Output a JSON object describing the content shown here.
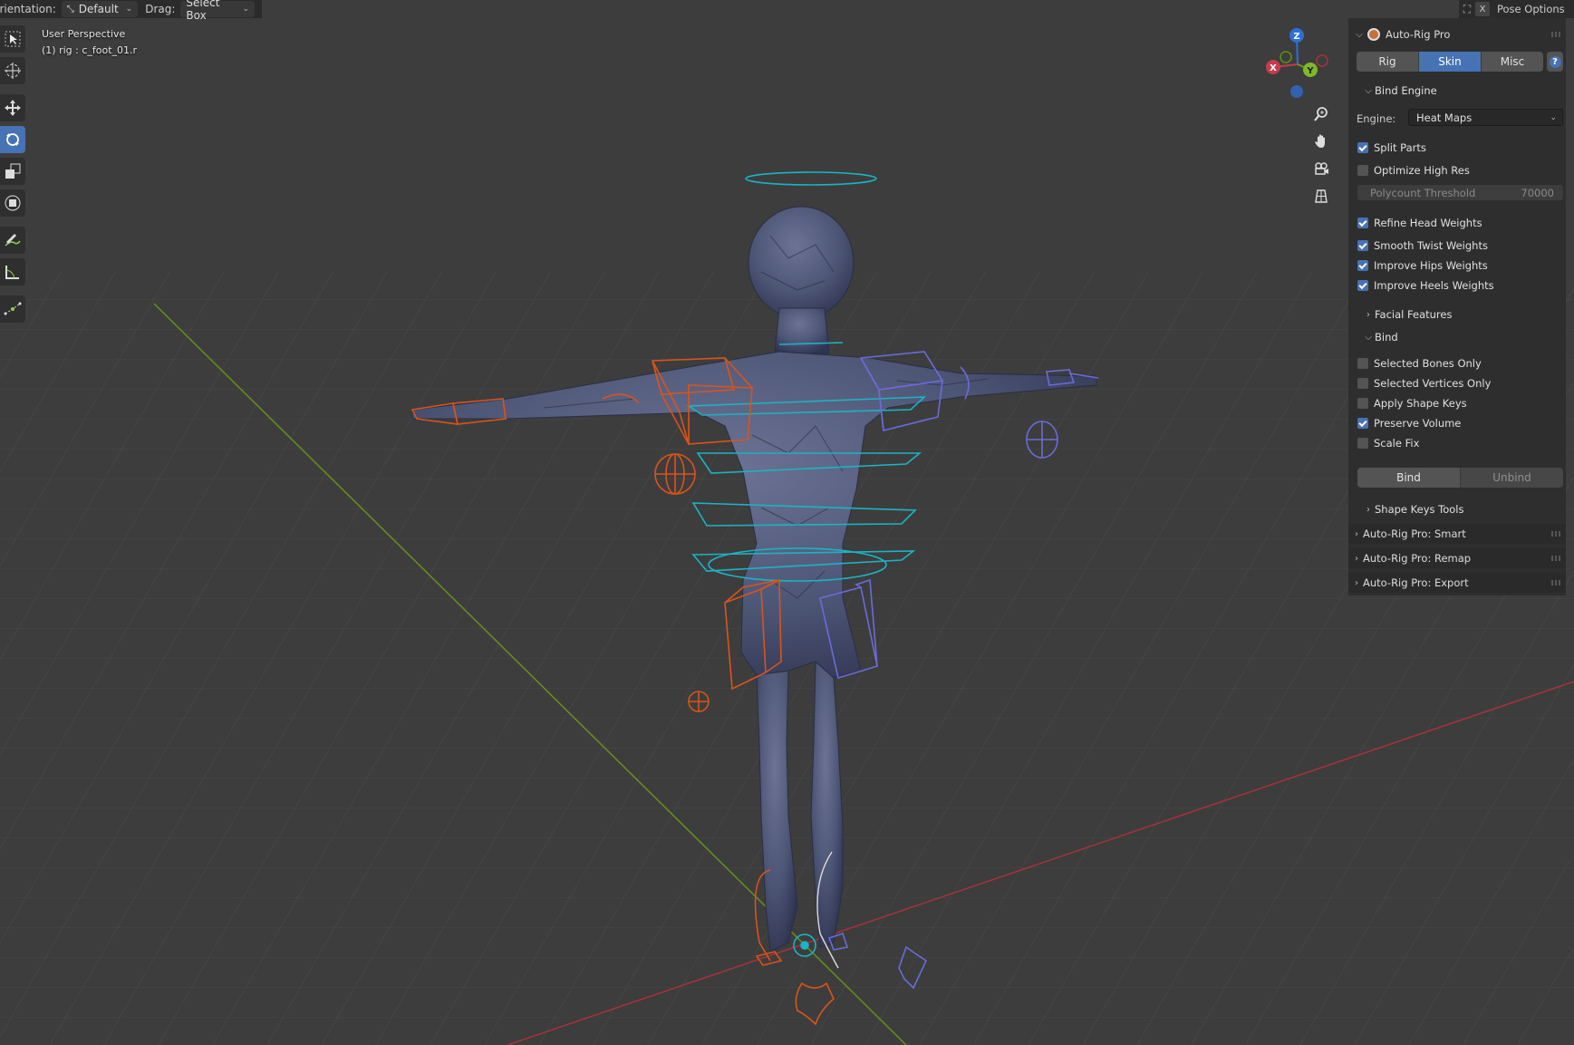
{
  "header": {
    "orientation_label": "Orientation:",
    "orientation_value": "Default",
    "drag_label": "Drag:",
    "drag_value": "Select Box",
    "close_label": "X",
    "pose_options": "Pose Options"
  },
  "viewport": {
    "perspective": "User Perspective",
    "selection": "(1) rig : c_foot_01.r"
  },
  "gizmo": {
    "z": "Z",
    "y": "Y",
    "x": "X"
  },
  "tools": [
    "select-box-icon",
    "cursor-icon",
    "move-icon",
    "rotate-icon",
    "scale-icon",
    "transform-icon",
    "annotate-icon",
    "measure-icon",
    "bone-curve-icon"
  ],
  "panel": {
    "title": "Auto-Rig Pro",
    "tabs": [
      "Rig",
      "Skin",
      "Misc"
    ],
    "active_tab": "Skin",
    "help": "?",
    "bind_engine": {
      "title": "Bind Engine",
      "engine_label": "Engine:",
      "engine_value": "Heat Maps",
      "split_parts": "Split Parts",
      "optimize_high_res": "Optimize High Res",
      "polycount_label": "Polycount Threshold",
      "polycount_value": "70000",
      "refine_head": "Refine Head Weights",
      "smooth_twist": "Smooth Twist Weights",
      "improve_hips": "Improve Hips Weights",
      "improve_heels": "Improve Heels Weights"
    },
    "facial_features": "Facial Features",
    "bind": {
      "title": "Bind",
      "selected_bones_only": "Selected Bones Only",
      "selected_vertices_only": "Selected Vertices Only",
      "apply_shape_keys": "Apply Shape Keys",
      "preserve_volume": "Preserve Volume",
      "scale_fix": "Scale Fix",
      "bind_button": "Bind",
      "unbind_button": "Unbind"
    },
    "shape_keys_tools": "Shape Keys Tools",
    "smart": "Auto-Rig Pro: Smart",
    "remap": "Auto-Rig Pro: Remap",
    "export": "Auto-Rig Pro: Export"
  },
  "colors": {
    "accent": "#4772b3",
    "background": "#3d3d3d",
    "panel": "#2e2e2e",
    "x_axis": "#c43c4d",
    "y_axis": "#6b9a1e",
    "z_axis": "#2d6fd6",
    "rig_orange": "#d9541b",
    "rig_cyan": "#1bb4c4",
    "rig_purple": "#6b6bd9"
  }
}
